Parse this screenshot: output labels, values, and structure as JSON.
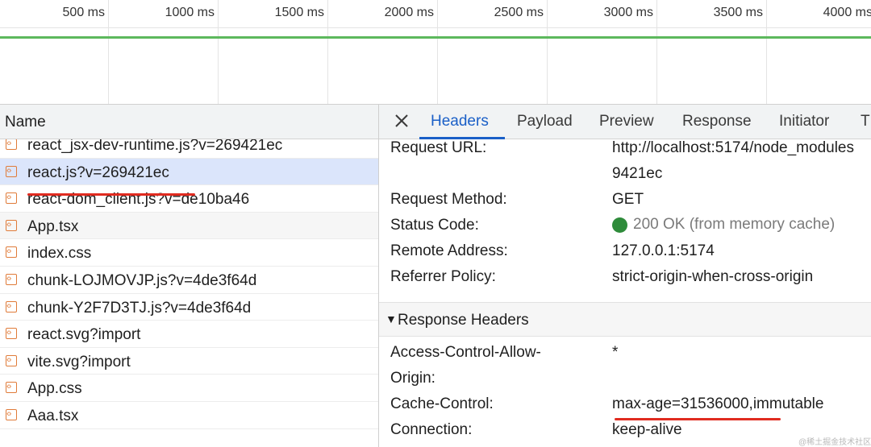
{
  "timeline": {
    "ticks": [
      "500 ms",
      "1000 ms",
      "1500 ms",
      "2000 ms",
      "2500 ms",
      "3000 ms",
      "3500 ms",
      "4000 ms"
    ],
    "bar_color": "#5cb85c"
  },
  "request_list": {
    "header": "Name",
    "rows": [
      {
        "name": "react_jsx-dev-runtime.js?v=269421ec",
        "icon": "script-file-icon"
      },
      {
        "name": "react.js?v=269421ec",
        "icon": "script-file-icon",
        "selected": true
      },
      {
        "name": "react-dom_client.js?v=de10ba46",
        "icon": "script-file-icon"
      },
      {
        "name": "App.tsx",
        "icon": "script-file-icon"
      },
      {
        "name": "index.css",
        "icon": "script-file-icon"
      },
      {
        "name": "chunk-LOJMOVJP.js?v=4de3f64d",
        "icon": "script-file-icon"
      },
      {
        "name": "chunk-Y2F7D3TJ.js?v=4de3f64d",
        "icon": "script-file-icon"
      },
      {
        "name": "react.svg?import",
        "icon": "script-file-icon"
      },
      {
        "name": "vite.svg?import",
        "icon": "script-file-icon"
      },
      {
        "name": "App.css",
        "icon": "script-file-icon"
      },
      {
        "name": "Aaa.tsx",
        "icon": "script-file-icon"
      }
    ],
    "highlight_color": "#e02b20"
  },
  "details": {
    "tabs": [
      "Headers",
      "Payload",
      "Preview",
      "Response",
      "Initiator",
      "T"
    ],
    "active_tab": "Headers",
    "general": {
      "request_url_label": "Request URL:",
      "request_url_value_line1": "http://localhost:5174/node_modules",
      "request_url_value_line2": "9421ec",
      "request_method_label": "Request Method:",
      "request_method_value": "GET",
      "status_code_label": "Status Code:",
      "status_code_value": "200 OK (from memory cache)",
      "remote_address_label": "Remote Address:",
      "remote_address_value": "127.0.0.1:5174",
      "referrer_policy_label": "Referrer Policy:",
      "referrer_policy_value": "strict-origin-when-cross-origin"
    },
    "response_headers": {
      "title": "Response Headers",
      "acao_label_line1": "Access-Control-Allow-",
      "acao_label_line2": "Origin:",
      "acao_value": "*",
      "cache_control_label": "Cache-Control:",
      "cache_control_value": "max-age=31536000,immutable",
      "connection_label": "Connection:",
      "connection_value": "keep-alive"
    },
    "status_color": "#2e8b3a",
    "accent_color": "#1a5fc7"
  },
  "watermark": "@稀土掘金技术社区"
}
